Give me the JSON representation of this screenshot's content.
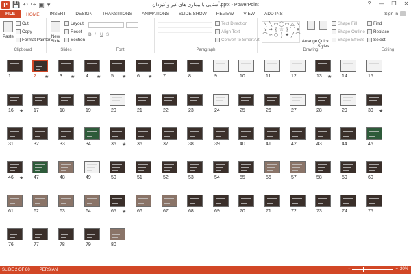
{
  "window": {
    "app_logo": "P",
    "title": "آشنایی با بیماری های کبر و کیزدان.pptx - PowerPoint",
    "minimize": "—",
    "restore": "❐",
    "close": "✕",
    "help": "?"
  },
  "qat": {
    "save": "💾",
    "undo": "↶",
    "redo": "↷",
    "start": "▣",
    "more": "▾"
  },
  "tabs": [
    "FILE",
    "HOME",
    "INSERT",
    "DESIGN",
    "TRANSITIONS",
    "ANIMATIONS",
    "SLIDE SHOW",
    "REVIEW",
    "VIEW",
    "ADD-INS"
  ],
  "active_tab": "HOME",
  "sign_in": "Sign in",
  "ribbon": {
    "clipboard": {
      "label": "Clipboard",
      "paste": "Paste",
      "cut": "Cut",
      "copy": "Copy",
      "format_painter": "Format Painter"
    },
    "slides": {
      "label": "Slides",
      "new_slide": "New Slide",
      "layout": "Layout",
      "reset": "Reset",
      "section": "Section"
    },
    "font": {
      "label": "Font"
    },
    "paragraph": {
      "label": "Paragraph",
      "text_direction": "Text Direction",
      "align_text": "Align Text",
      "smartart": "Convert to SmartArt"
    },
    "drawing": {
      "label": "Drawing",
      "arrange": "Arrange",
      "quick_styles": "Quick Styles",
      "shape_fill": "Shape Fill",
      "shape_outline": "Shape Outline",
      "shape_effects": "Shape Effects"
    },
    "editing": {
      "label": "Editing",
      "find": "Find",
      "replace": "Replace",
      "select": "Select"
    }
  },
  "slides": {
    "count": 80,
    "selected": 2,
    "starred": [
      2,
      3,
      4,
      5,
      6,
      13,
      16,
      30,
      35,
      46,
      65
    ],
    "light": [
      9,
      10,
      11,
      12,
      14,
      15,
      20,
      24,
      27,
      29,
      49
    ],
    "green": [
      27,
      34,
      45,
      47
    ],
    "photo": [
      48,
      49,
      56,
      57,
      61,
      62,
      63,
      64,
      66,
      67,
      80
    ]
  },
  "status": {
    "slide_info": "SLIDE 2 OF 80",
    "language": "PERSIAN",
    "zoom": "20%"
  }
}
